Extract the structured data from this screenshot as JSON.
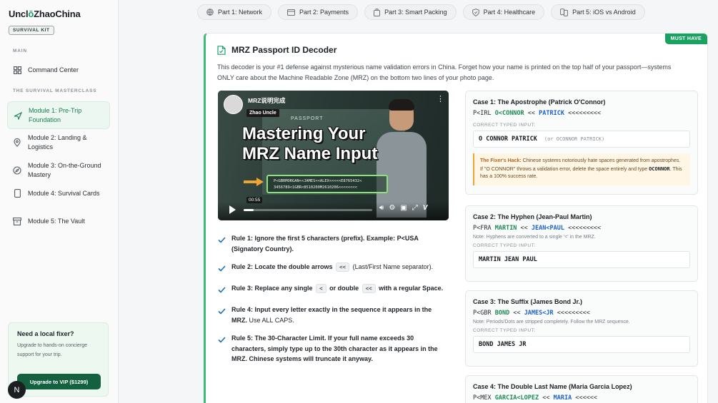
{
  "brand": {
    "pre": "Uncl",
    "accent": "ō",
    "post": "ZhaoChina",
    "badge": "SURVIVAL KIT"
  },
  "sidebar": {
    "main_label": "MAIN",
    "command_center": "Command Center",
    "masterclass_label": "THE SURVIVAL MASTERCLASS",
    "modules": [
      {
        "label": "Module 1: Pre-Trip Foundation",
        "icon": "plane-icon",
        "active": true
      },
      {
        "label": "Module 2: Landing & Logistics",
        "icon": "map-pin-icon"
      },
      {
        "label": "Module 3: On-the-Ground Mastery",
        "icon": "compass-icon"
      },
      {
        "label": "Module 4: Survival Cards",
        "icon": "phone-icon"
      },
      {
        "label": "Module 5: The Vault",
        "icon": "archive-icon"
      }
    ],
    "fixer": {
      "title": "Need a local fixer?",
      "desc": "Upgrade to hands-on concierge support for your trip.",
      "cta": "Upgrade to VIP ($1299)"
    },
    "avatar": "N"
  },
  "tabs": [
    {
      "label": "Part 1: Network",
      "icon": "globe-icon"
    },
    {
      "label": "Part 2: Payments",
      "icon": "card-icon"
    },
    {
      "label": "Part 3: Smart Packing",
      "icon": "luggage-icon"
    },
    {
      "label": "Part 4: Healthcare",
      "icon": "shield-icon"
    },
    {
      "label": "Part 5: iOS vs Android",
      "icon": "phones-icon"
    }
  ],
  "card": {
    "badge": "MUST HAVE",
    "title": "MRZ Passport ID Decoder",
    "intro": "This decoder is your #1 defense against mysterious name validation errors in China. Forget how your name is printed on the top half of your passport—systems ONLY care about the Machine Readable Zone (MRZ) on the bottom two lines of your photo page."
  },
  "video": {
    "title": "MRZ说明完成",
    "channel": "Zhao Uncle",
    "passport_label": "PASSPORT",
    "overlay_line1": "Mastering Your",
    "overlay_line2": "MRZ Name Input",
    "mrz_line1": "P<GBRMORGAN<<JAMES<<ALEX<<<<<E8765432<",
    "mrz_line2": "3456789<1GBR<8510200M2610206<<<<<<<<",
    "duration": "00:55",
    "progress": 0.08
  },
  "rules": [
    {
      "bold": "Rule 1: Ignore the first 5 characters (prefix). Example: P<USA (Signatory Country).",
      "rest": ""
    },
    {
      "bold": "Rule 2: Locate the double arrows",
      "code": "<<",
      "rest": "(Last/First Name separator)."
    },
    {
      "bold": "Rule 3: Replace any single",
      "code": "<",
      "bold2": "or double",
      "code2": "<<",
      "bold3": "with a regular Space."
    },
    {
      "bold": "Rule 4: Input every letter exactly in the sequence it appears in the MRZ.",
      "rest": "Use ALL CAPS."
    },
    {
      "bold": "Rule 5: The 30-Character Limit. If your full name exceeds 30 characters, simply type up to the 30th character as it appears in the MRZ. Chinese systems will truncate it anyway.",
      "rest": ""
    }
  ],
  "cases": {
    "c1": {
      "title": "Case 1: The Apostrophe (Patrick O'Connor)",
      "mrz_prefix": "P<IRL ",
      "mrz_last": "O<CONNOR",
      "mrz_sep": " << ",
      "mrz_first": "PATRICK",
      "mrz_fill": " <<<<<<<<<",
      "typed_label": "CORRECT TYPED INPUT:",
      "typed": "O CONNOR PATRICK",
      "typed_alt": "(or OCONNOR PATRICK)",
      "hack_label": "The Fixer's Hack:",
      "hack_text": "Chinese systems notoriously hate spaces generated from apostrophes. If \"O CONNOR\" throws a validation error, delete the space entirely and type",
      "hack_code": "OCONNOR",
      "hack_tail": ". This has a 100% success rate."
    },
    "c2": {
      "title": "Case 2: The Hyphen (Jean-Paul Martin)",
      "mrz_prefix": "P<FRA ",
      "mrz_last": "MARTIN",
      "mrz_sep": " << ",
      "mrz_first": "JEAN<PAUL",
      "mrz_fill": " <<<<<<<<<",
      "note": "Note: Hyphens are converted to a single '<' in the MRZ.",
      "typed_label": "CORRECT TYPED INPUT:",
      "typed": "MARTIN JEAN PAUL"
    },
    "c3": {
      "title": "Case 3: The Suffix (James Bond Jr.)",
      "mrz_prefix": "P<GBR ",
      "mrz_last": "BOND",
      "mrz_sep": " << ",
      "mrz_first": "JAMES<JR",
      "mrz_fill": " <<<<<<<<<",
      "note": "Note: Periods/Dots are stripped completely. Follow the MRZ sequence.",
      "typed_label": "CORRECT TYPED INPUT:",
      "typed": "BOND JAMES JR"
    },
    "c4": {
      "title": "Case 4: The Double Last Name (Maria Garcia Lopez)",
      "mrz_prefix": "P<MEX ",
      "mrz_last": "GARCIA<LOPEZ",
      "mrz_sep": " << ",
      "mrz_first": "MARIA",
      "mrz_fill": " <<<<<<"
    }
  },
  "colors": {
    "accent": "#1aa06d",
    "mrz_last": "#1f8a56",
    "mrz_first": "#1d62c9",
    "vip": "#13613f"
  }
}
